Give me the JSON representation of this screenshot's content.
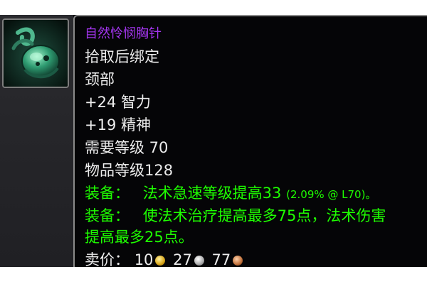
{
  "item": {
    "name": "自然怜悯胸针",
    "bind": "拾取后绑定",
    "slot": "颈部",
    "stat1": "+24 智力",
    "stat2": "+19 精神",
    "req_level": "需要等级 70",
    "item_level": "物品等级128",
    "equip1_label": "装备：",
    "equip1_text": "法术急速等级提高33",
    "equip1_detail": "(2.09% @ L70)。",
    "equip2_label": "装备：",
    "equip2_text": "使法术治疗提高最多75点，法术伤害",
    "equip2_text_cont": "提高最多25点。",
    "sell_label": "卖价：",
    "sell_gold": "10",
    "sell_silver": "27",
    "sell_copper": "77"
  },
  "colors": {
    "epic_name": "#a335ee",
    "equip_green": "#1eff00",
    "text": "#ececec"
  },
  "icon": "teal-brooch-icon"
}
